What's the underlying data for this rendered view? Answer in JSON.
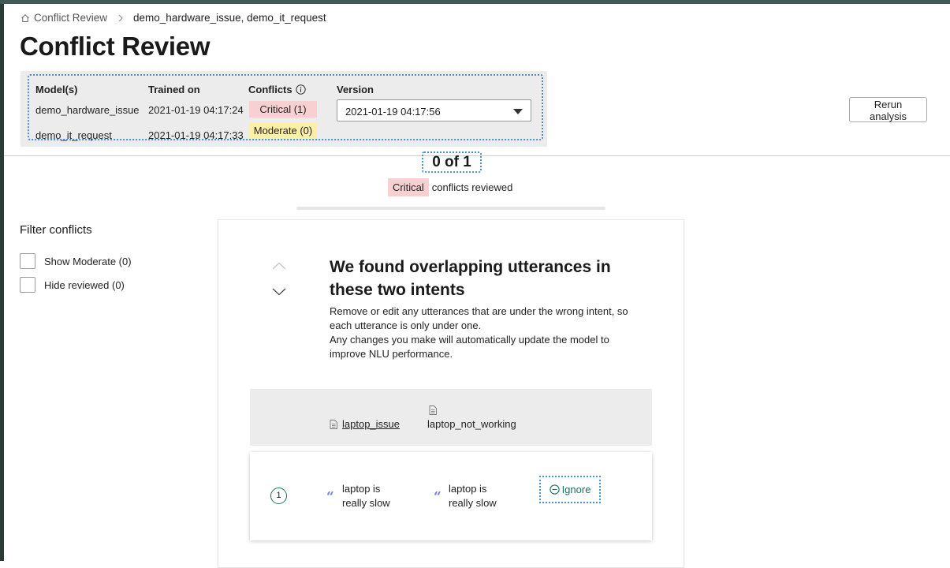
{
  "breadcrumb": {
    "root_label": "Conflict Review",
    "current_label": "demo_hardware_issue, demo_it_request"
  },
  "page_title": "Conflict Review",
  "models_table": {
    "headers": {
      "models": "Model(s)",
      "trained_on": "Trained on",
      "conflicts": "Conflicts",
      "version": "Version"
    },
    "rows": [
      {
        "model": "demo_hardware_issue",
        "trained_on": "2021-01-19 04:17:24",
        "conflict_badge": "Critical (1)"
      },
      {
        "model": "demo_it_request",
        "trained_on": "2021-01-19 04:17:33",
        "conflict_badge": "Moderate (0)"
      }
    ],
    "version_selected": "2021-01-19 04:17:56"
  },
  "rerun_button": "Rerun analysis",
  "review": {
    "counter": "0 of 1",
    "severity_badge": "Critical",
    "suffix": "conflicts reviewed",
    "progress": 0
  },
  "filter": {
    "title": "Filter conflicts",
    "options": [
      {
        "label": "Show Moderate (0)",
        "checked": false
      },
      {
        "label": "Hide reviewed (0)",
        "checked": false
      }
    ]
  },
  "conflict_card": {
    "title": "We found overlapping utterances in these two intents",
    "description_1": "Remove or edit any utterances that are under the wrong intent, so each utterance is only under one.",
    "description_2": "Any changes you make will automatically update the model to improve NLU performance.",
    "intents": [
      "laptop_issue",
      "laptop_not_working"
    ],
    "rows": [
      {
        "index": "1",
        "utterance_a": "laptop is really slow",
        "utterance_b": "laptop is really slow",
        "action": "Ignore"
      }
    ]
  },
  "colors": {
    "critical": "#f8d0d2",
    "moderate": "#fdf0a6",
    "accent_green": "#1e6f5c",
    "focus_outline": "#4a90d9",
    "quote": "#7a7adc"
  }
}
